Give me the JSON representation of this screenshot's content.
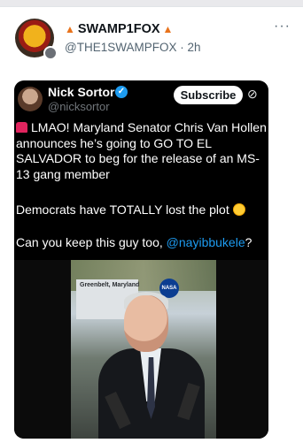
{
  "author": {
    "display_name": "SWAMP1FOX",
    "handle": "@THE1SWAMPFOX",
    "separator": "·",
    "time": "2h",
    "more_glyph": "···"
  },
  "embedded": {
    "author_name": "Nick Sortor",
    "author_handle": "@nicksortor",
    "subscribe_label": "Subscribe",
    "grok_glyph": "⊘",
    "text_p1": "LMAO! Maryland Senator Chris Van Hollen announces he’s going to GO TO EL SALVADOR to beg for the release of an MS-13 gang member",
    "text_p2": "Democrats have TOTALLY lost the plot",
    "text_p3_prefix": "Can you keep this guy too, ",
    "text_p3_mention": "@nayibbukele",
    "text_p3_suffix": "?",
    "video_sign_text": "Greenbelt, Maryland",
    "video_logo_text": "NASA"
  },
  "colors": {
    "accent": "#1d9bf0",
    "fox_icon": "#e8731c",
    "alarm_icon": "#e0245e"
  },
  "icons": {
    "fox": "fox-face-icon",
    "verified": "verified-badge-icon",
    "alarm": "rotating-light-icon",
    "laugh": "rolling-laughing-emoji"
  }
}
